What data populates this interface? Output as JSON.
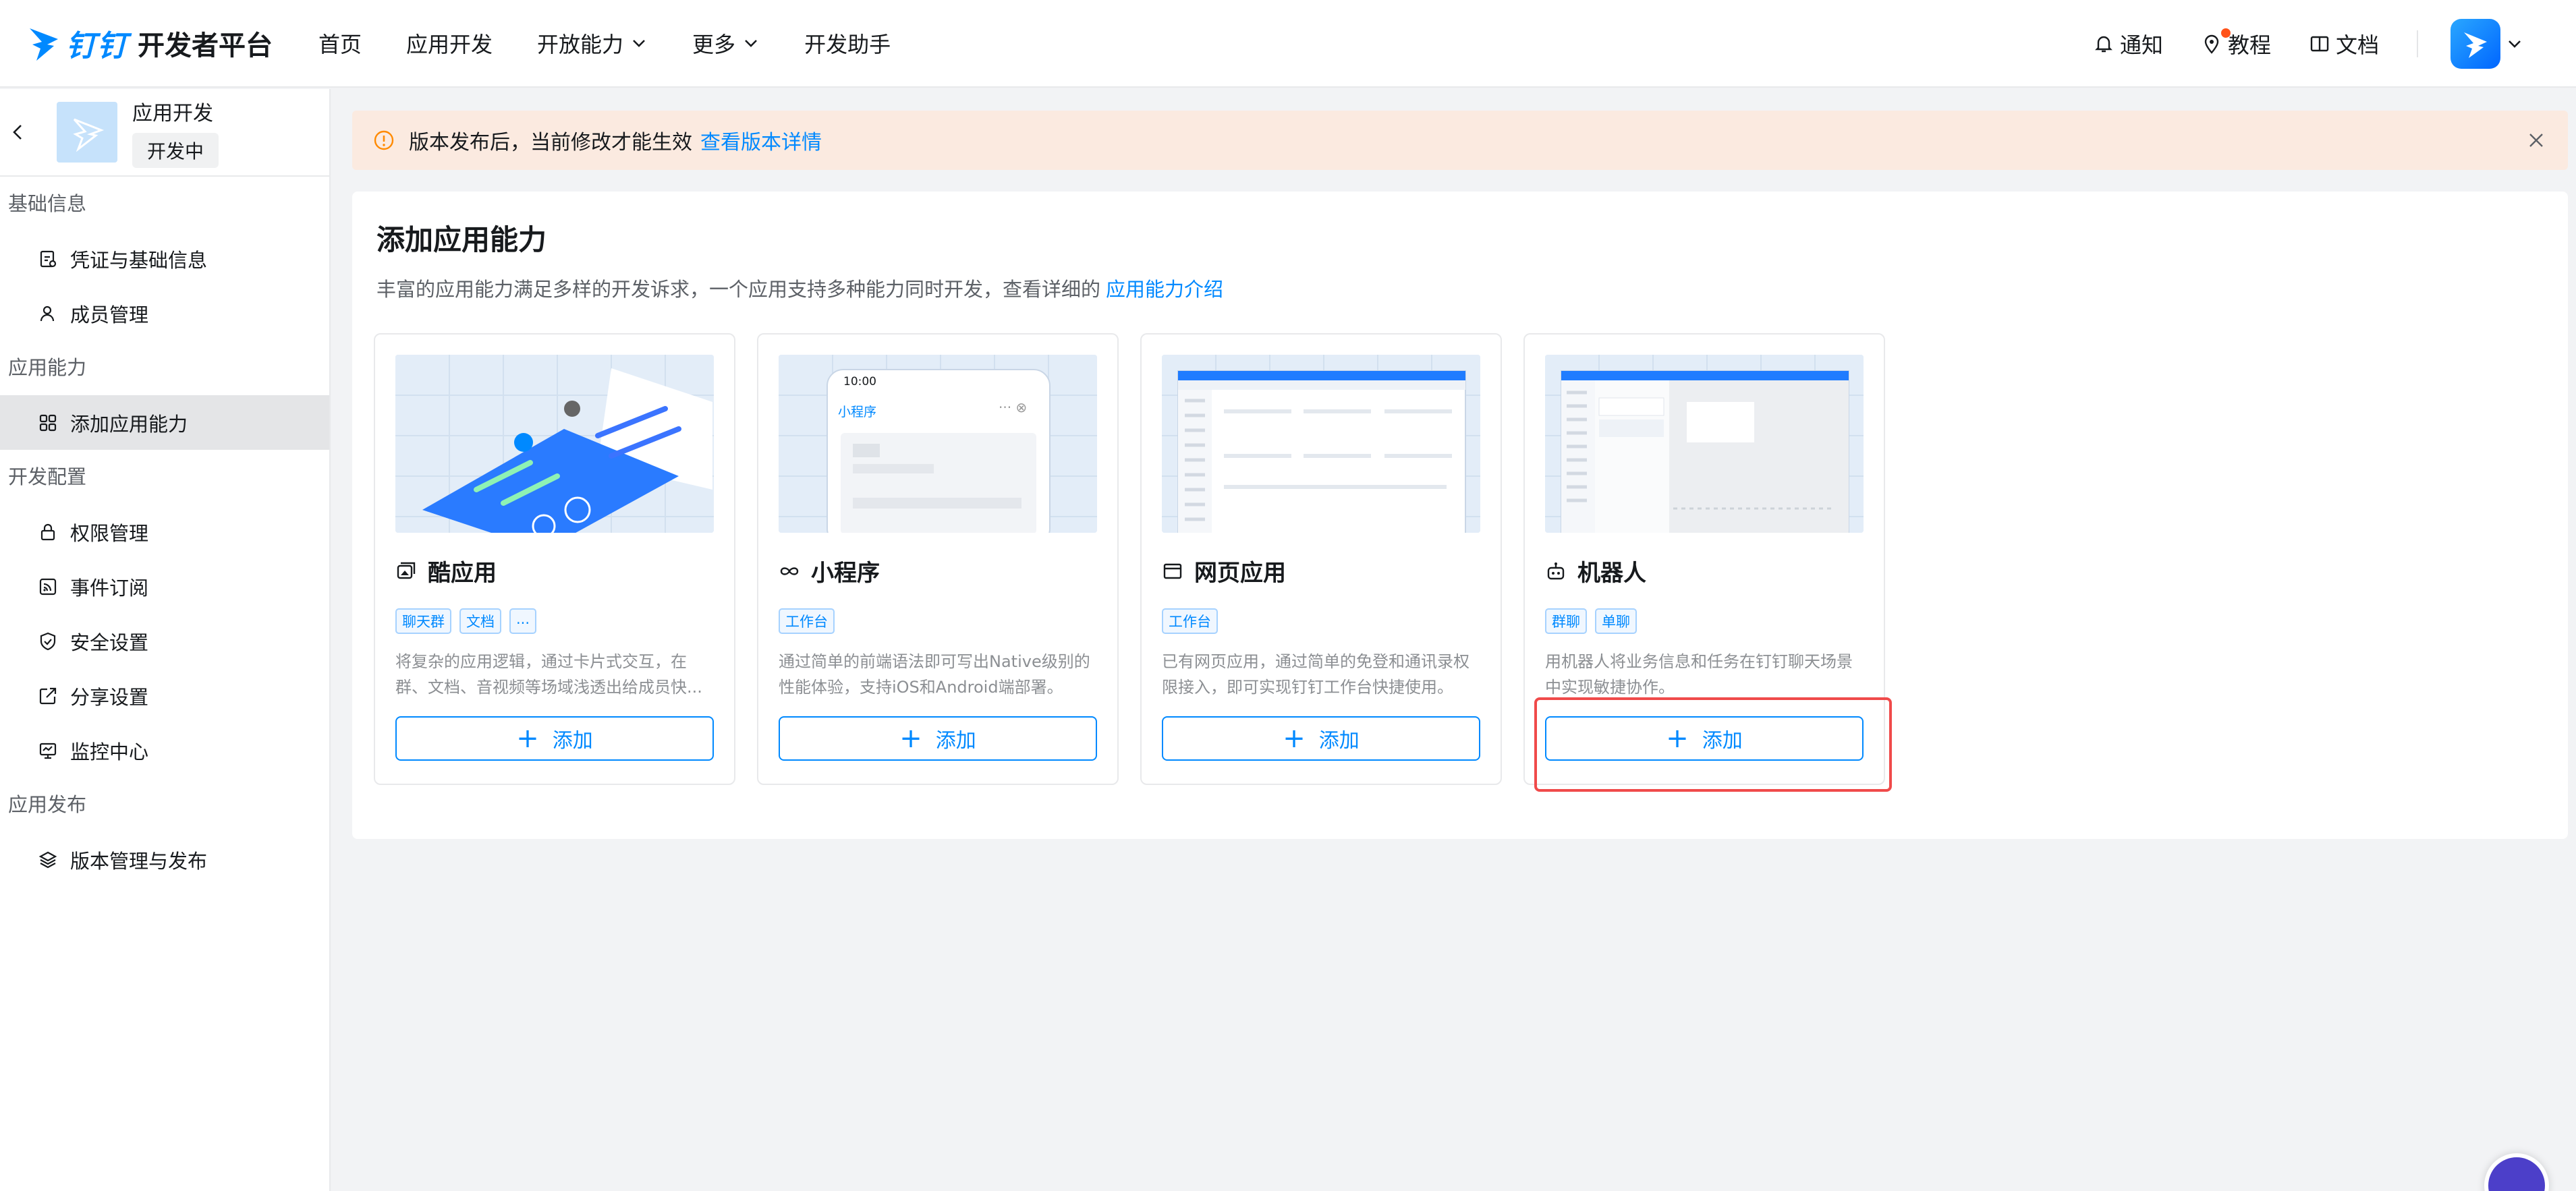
{
  "brand": {
    "word": "钉钉",
    "subtitle": "开发者平台",
    "color": "#0089ff"
  },
  "nav": {
    "items": [
      {
        "label": "首页",
        "dropdown": false
      },
      {
        "label": "应用开发",
        "dropdown": false
      },
      {
        "label": "开放能力",
        "dropdown": true
      },
      {
        "label": "更多",
        "dropdown": true
      },
      {
        "label": "开发助手",
        "dropdown": false
      }
    ],
    "right": {
      "notify": "通知",
      "tutorial": "教程",
      "docs": "文档"
    }
  },
  "sidebar": {
    "app": {
      "name": "应用开发",
      "status": "开发中"
    },
    "groups": [
      {
        "title": "基础信息",
        "items": [
          {
            "label": "凭证与基础信息",
            "icon": "credential-icon"
          },
          {
            "label": "成员管理",
            "icon": "user-icon"
          }
        ]
      },
      {
        "title": "应用能力",
        "items": [
          {
            "label": "添加应用能力",
            "icon": "grid-icon",
            "active": true
          }
        ]
      },
      {
        "title": "开发配置",
        "items": [
          {
            "label": "权限管理",
            "icon": "lock-icon"
          },
          {
            "label": "事件订阅",
            "icon": "rss-icon"
          },
          {
            "label": "安全设置",
            "icon": "shield-icon"
          },
          {
            "label": "分享设置",
            "icon": "share-icon"
          },
          {
            "label": "监控中心",
            "icon": "monitor-icon"
          }
        ]
      },
      {
        "title": "应用发布",
        "items": [
          {
            "label": "版本管理与发布",
            "icon": "layers-icon"
          }
        ]
      }
    ]
  },
  "banner": {
    "text": "版本发布后，当前修改才能生效",
    "link": "查看版本详情"
  },
  "panel": {
    "title": "添加应用能力",
    "desc": "丰富的应用能力满足多样的开发诉求，一个应用支持多种能力同时开发，查看详细的",
    "desc_link": "应用能力介绍"
  },
  "cards": [
    {
      "title": "酷应用",
      "icon": "cool-app-icon",
      "tags": [
        "聊天群",
        "文档",
        "..."
      ],
      "desc": "将复杂的应用逻辑，通过卡片式交互，在群、文档、音视频等场域浅透出给成员快...",
      "button": "添加"
    },
    {
      "title": "小程序",
      "icon": "mini-program-icon",
      "tags": [
        "工作台"
      ],
      "desc": "通过简单的前端语法即可写出Native级别的性能体验，支持iOS和Android端部署。",
      "button": "添加",
      "mock": {
        "time": "10:00",
        "name": "小程序"
      }
    },
    {
      "title": "网页应用",
      "icon": "web-app-icon",
      "tags": [
        "工作台"
      ],
      "desc": "已有网页应用，通过简单的免登和通讯录权限接入，即可实现钉钉工作台快捷使用。",
      "button": "添加"
    },
    {
      "title": "机器人",
      "icon": "robot-icon",
      "tags": [
        "群聊",
        "单聊"
      ],
      "desc": "用机器人将业务信息和任务在钉钉聊天场景中实现敏捷协作。",
      "button": "添加"
    }
  ]
}
